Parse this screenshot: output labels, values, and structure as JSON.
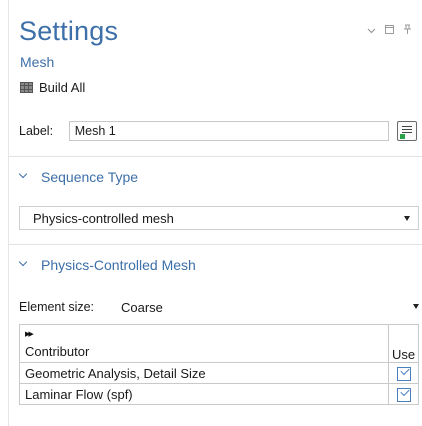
{
  "header": {
    "title": "Settings",
    "subtitle": "Mesh",
    "build_all_label": "Build All"
  },
  "window_controls": [
    "chevron-down-icon",
    "restore-icon",
    "pin-icon"
  ],
  "label_field": {
    "label": "Label:",
    "value": "Mesh 1"
  },
  "sections": {
    "sequence_type": {
      "title": "Sequence Type",
      "selected": "Physics-controlled mesh"
    },
    "physics_controlled_mesh": {
      "title": "Physics-Controlled Mesh",
      "element_size_label": "Element size:",
      "element_size_value": "Coarse",
      "table": {
        "headers": {
          "contributor": "Contributor",
          "use": "Use"
        },
        "rows": [
          {
            "contributor": "Geometric Analysis, Detail Size",
            "use": true
          },
          {
            "contributor": "Laminar Flow (spf)",
            "use": true
          }
        ]
      }
    }
  },
  "colors": {
    "accent": "#3d6fa8",
    "checkbox": "#4a7fbf",
    "border": "#c9c9c9"
  }
}
